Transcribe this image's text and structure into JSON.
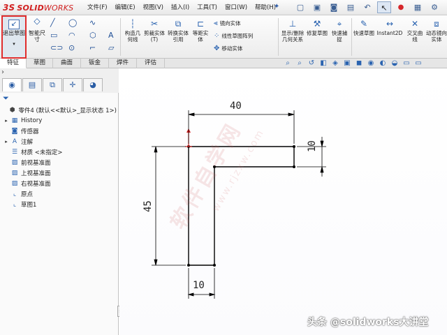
{
  "app": {
    "logo_ds": "3S",
    "logo_solid": "SOLID",
    "logo_works": "WORKS",
    "menus": [
      "文件(F)",
      "编辑(E)",
      "视图(V)",
      "插入(I)",
      "工具(T)",
      "窗口(W)",
      "帮助(H)"
    ]
  },
  "ribbon": {
    "exit_sketch": "退出草图",
    "smart_dimension": "智能尺寸",
    "construction_geometry": "构造几何线",
    "trim_entities": "剪裁实体(T)",
    "convert_entities": "转换实体引用",
    "offset_entities": "等距实体",
    "mirror_entities": "镜向实体",
    "linear_pattern": "线性草图阵列",
    "move_entities": "移动实体",
    "display_relations": "显示/删除几何关系",
    "repair_sketch": "修复草图",
    "quick_snaps": "快速捕捉",
    "rapid_sketch": "快速草图",
    "instant2d": "Instant2D",
    "cross_curve": "交叉曲线",
    "dynamic_mirror": "动态镜向实体"
  },
  "tabs": [
    "特征",
    "草图",
    "曲面",
    "钣金",
    "焊件",
    "评估"
  ],
  "active_tab": "特征",
  "tree": {
    "root": "零件4 (默认<<默认>_显示状态 1>)",
    "items": [
      "History",
      "传感器",
      "注解",
      "材质 <未指定>",
      "前视基准面",
      "上视基准面",
      "右视基准面",
      "原点",
      "草图1"
    ]
  },
  "sketch": {
    "dim_top": "40",
    "dim_right": "10",
    "dim_left": "45",
    "dim_bottom": "10"
  },
  "watermark": {
    "main": "软件自学网",
    "url": "www.rjzxw.com"
  },
  "credit": "头条 @solidworks大讲堂",
  "colors": {
    "accent_red": "#e02d2d",
    "icon_blue": "#2a63b0"
  }
}
